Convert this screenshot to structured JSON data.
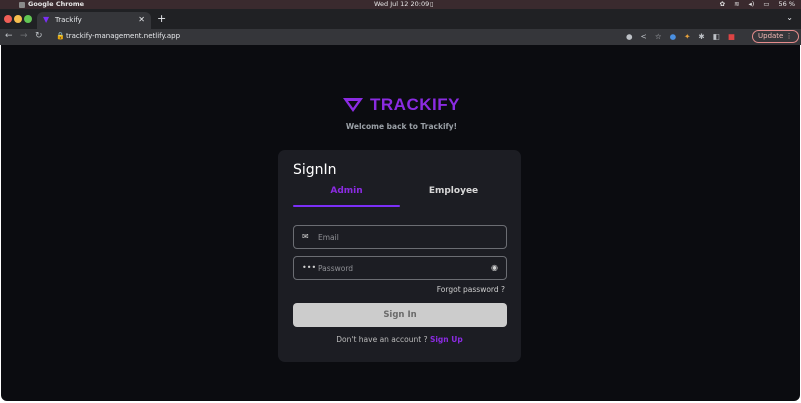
{
  "os": {
    "app_name": "Google Chrome",
    "clock": "Wed Jul 12  20:09",
    "battery": "56 %"
  },
  "browser": {
    "tab_title": "Trackify",
    "url": "trackify-management.netlify.app",
    "update_label": "Update"
  },
  "brand": {
    "name": "TRACKIFY",
    "welcome": "Welcome back to Trackify!",
    "color": "#8b2be2"
  },
  "signin": {
    "title": "SignIn",
    "tabs": [
      "Admin",
      "Employee"
    ],
    "active_tab": "Admin",
    "email_placeholder": "Email",
    "password_placeholder": "Password",
    "forgot_label": "Forgot password ?",
    "button_label": "Sign In",
    "signup_prompt": "Don't have an account ? ",
    "signup_link": "Sign Up"
  }
}
